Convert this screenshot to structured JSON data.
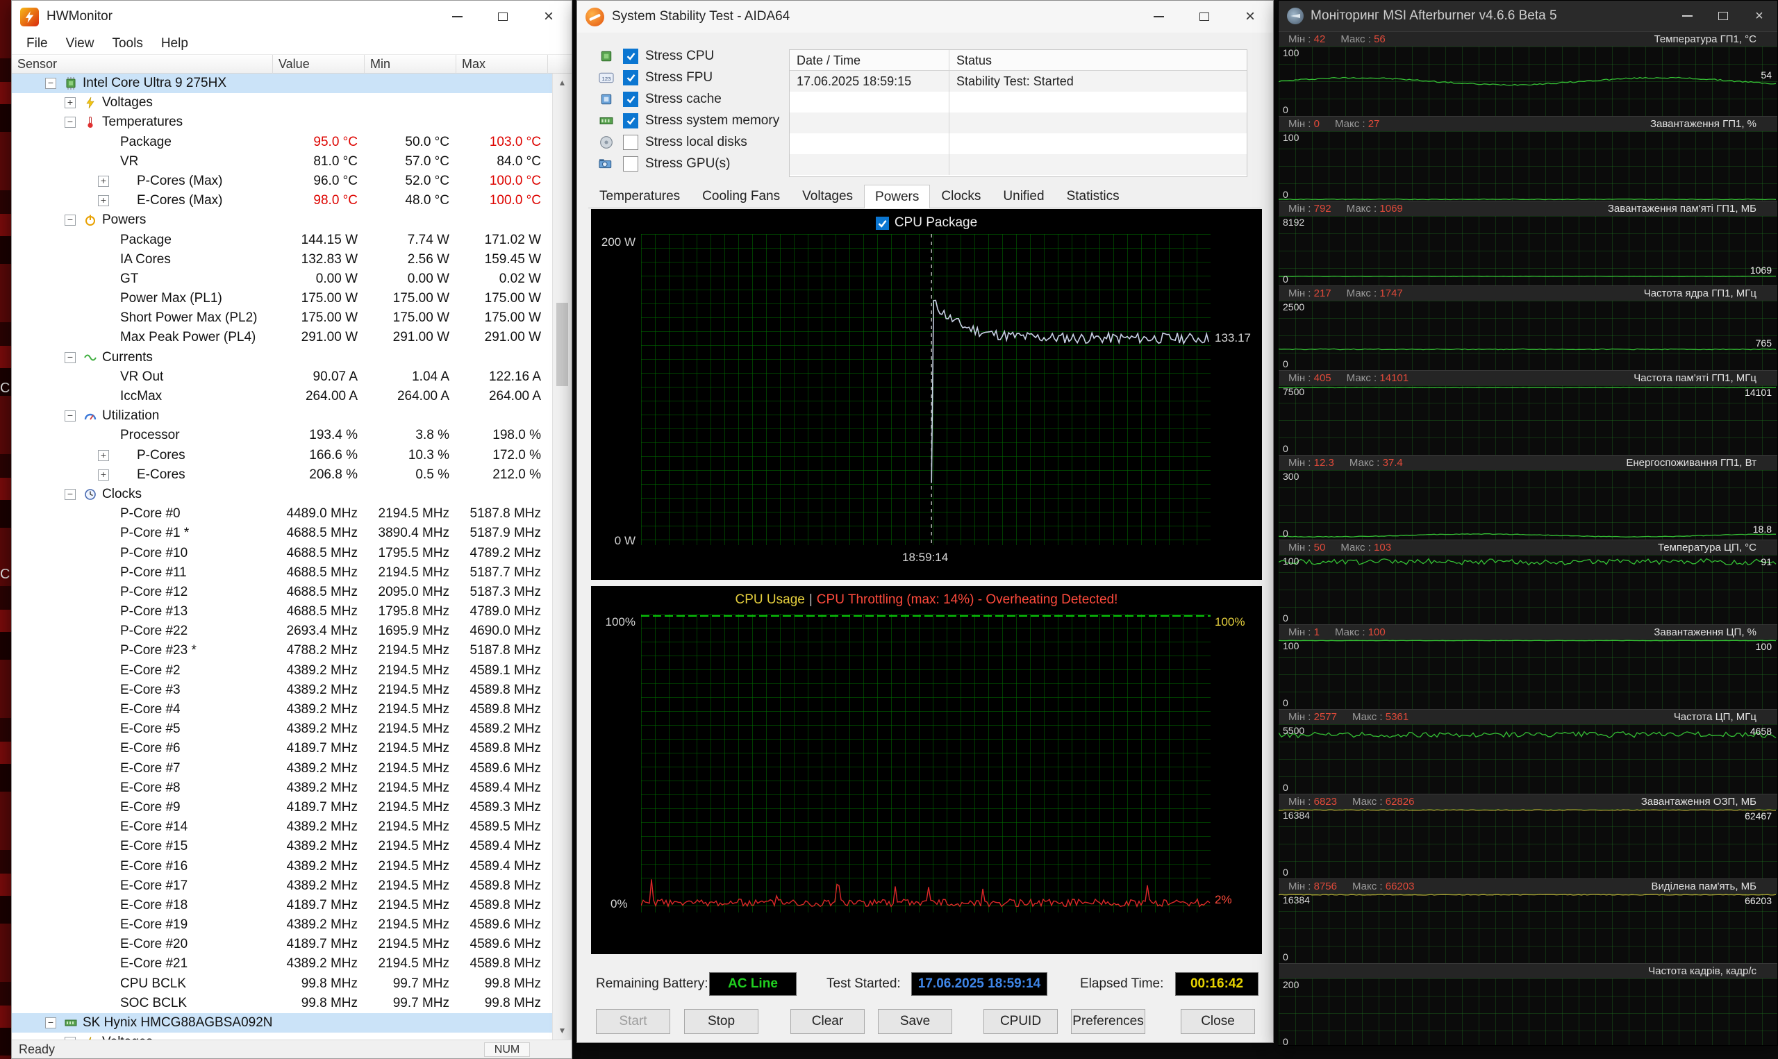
{
  "desktop": {
    "letters": [
      "C",
      "C"
    ]
  },
  "hwmonitor": {
    "title": "HWMonitor",
    "menu": [
      "File",
      "View",
      "Tools",
      "Help"
    ],
    "columns": {
      "sensor": "Sensor",
      "value": "Value",
      "min": "Min",
      "max": "Max"
    },
    "status": {
      "left": "Ready",
      "right": "NUM"
    },
    "rows": [
      {
        "kind": "device",
        "icon": "chip-icon",
        "label": "Intel Core Ultra 9 275HX",
        "selected": true,
        "expand": "-"
      },
      {
        "kind": "group",
        "icon": "voltage-icon",
        "label": "Voltages",
        "expand": "+"
      },
      {
        "kind": "group",
        "icon": "temperature-icon",
        "label": "Temperatures",
        "expand": "-"
      },
      {
        "kind": "leaf",
        "label": "Package",
        "value": "95.0 °C",
        "min": "50.0 °C",
        "max": "103.0 °C",
        "valueRed": true,
        "maxRed": true
      },
      {
        "kind": "leaf",
        "label": "VR",
        "value": "81.0 °C",
        "min": "57.0 °C",
        "max": "84.0 °C"
      },
      {
        "kind": "leaf",
        "label": "P-Cores (Max)",
        "value": "96.0 °C",
        "min": "52.0 °C",
        "max": "100.0 °C",
        "expand": "+",
        "maxRed": true
      },
      {
        "kind": "leaf",
        "label": "E-Cores (Max)",
        "value": "98.0 °C",
        "min": "48.0 °C",
        "max": "100.0 °C",
        "expand": "+",
        "valueRed": true,
        "maxRed": true
      },
      {
        "kind": "group",
        "icon": "power-icon",
        "label": "Powers",
        "expand": "-"
      },
      {
        "kind": "leaf",
        "label": "Package",
        "value": "144.15 W",
        "min": "7.74 W",
        "max": "171.02 W"
      },
      {
        "kind": "leaf",
        "label": "IA Cores",
        "value": "132.83 W",
        "min": "2.56 W",
        "max": "159.45 W"
      },
      {
        "kind": "leaf",
        "label": "GT",
        "value": "0.00 W",
        "min": "0.00 W",
        "max": "0.02 W"
      },
      {
        "kind": "leaf",
        "label": "Power Max (PL1)",
        "value": "175.00 W",
        "min": "175.00 W",
        "max": "175.00 W"
      },
      {
        "kind": "leaf",
        "label": "Short Power Max (PL2)",
        "value": "175.00 W",
        "min": "175.00 W",
        "max": "175.00 W"
      },
      {
        "kind": "leaf",
        "label": "Max Peak Power (PL4)",
        "value": "291.00 W",
        "min": "291.00 W",
        "max": "291.00 W"
      },
      {
        "kind": "group",
        "icon": "current-icon",
        "label": "Currents",
        "expand": "-"
      },
      {
        "kind": "leaf",
        "label": "VR Out",
        "value": "90.07 A",
        "min": "1.04 A",
        "max": "122.16 A"
      },
      {
        "kind": "leaf",
        "label": "IccMax",
        "value": "264.00 A",
        "min": "264.00 A",
        "max": "264.00 A"
      },
      {
        "kind": "group",
        "icon": "utilization-icon",
        "label": "Utilization",
        "expand": "-"
      },
      {
        "kind": "leaf",
        "label": "Processor",
        "value": "193.4 %",
        "min": "3.8 %",
        "max": "198.0 %"
      },
      {
        "kind": "leaf",
        "label": "P-Cores",
        "value": "166.6 %",
        "min": "10.3 %",
        "max": "172.0 %",
        "expand": "+"
      },
      {
        "kind": "leaf",
        "label": "E-Cores",
        "value": "206.8 %",
        "min": "0.5 %",
        "max": "212.0 %",
        "expand": "+"
      },
      {
        "kind": "group",
        "icon": "clock-icon",
        "label": "Clocks",
        "expand": "-"
      },
      {
        "kind": "leaf",
        "label": "P-Core #0",
        "value": "4489.0 MHz",
        "min": "2194.5 MHz",
        "max": "5187.8 MHz"
      },
      {
        "kind": "leaf",
        "label": "P-Core #1 *",
        "value": "4688.5 MHz",
        "min": "3890.4 MHz",
        "max": "5187.9 MHz"
      },
      {
        "kind": "leaf",
        "label": "P-Core #10",
        "value": "4688.5 MHz",
        "min": "1795.5 MHz",
        "max": "4789.2 MHz"
      },
      {
        "kind": "leaf",
        "label": "P-Core #11",
        "value": "4688.5 MHz",
        "min": "2194.5 MHz",
        "max": "5187.7 MHz"
      },
      {
        "kind": "leaf",
        "label": "P-Core #12",
        "value": "4688.5 MHz",
        "min": "2095.0 MHz",
        "max": "5187.3 MHz"
      },
      {
        "kind": "leaf",
        "label": "P-Core #13",
        "value": "4688.5 MHz",
        "min": "1795.8 MHz",
        "max": "4789.0 MHz"
      },
      {
        "kind": "leaf",
        "label": "P-Core #22",
        "value": "2693.4 MHz",
        "min": "1695.9 MHz",
        "max": "4690.0 MHz"
      },
      {
        "kind": "leaf",
        "label": "P-Core #23 *",
        "value": "4788.2 MHz",
        "min": "2194.5 MHz",
        "max": "5187.8 MHz"
      },
      {
        "kind": "leaf",
        "label": "E-Core #2",
        "value": "4389.2 MHz",
        "min": "2194.5 MHz",
        "max": "4589.1 MHz"
      },
      {
        "kind": "leaf",
        "label": "E-Core #3",
        "value": "4389.2 MHz",
        "min": "2194.5 MHz",
        "max": "4589.8 MHz"
      },
      {
        "kind": "leaf",
        "label": "E-Core #4",
        "value": "4389.2 MHz",
        "min": "2194.5 MHz",
        "max": "4589.8 MHz"
      },
      {
        "kind": "leaf",
        "label": "E-Core #5",
        "value": "4389.2 MHz",
        "min": "2194.5 MHz",
        "max": "4589.2 MHz"
      },
      {
        "kind": "leaf",
        "label": "E-Core #6",
        "value": "4189.7 MHz",
        "min": "2194.5 MHz",
        "max": "4589.8 MHz"
      },
      {
        "kind": "leaf",
        "label": "E-Core #7",
        "value": "4389.2 MHz",
        "min": "2194.5 MHz",
        "max": "4589.6 MHz"
      },
      {
        "kind": "leaf",
        "label": "E-Core #8",
        "value": "4389.2 MHz",
        "min": "2194.5 MHz",
        "max": "4589.4 MHz"
      },
      {
        "kind": "leaf",
        "label": "E-Core #9",
        "value": "4189.7 MHz",
        "min": "2194.5 MHz",
        "max": "4589.3 MHz"
      },
      {
        "kind": "leaf",
        "label": "E-Core #14",
        "value": "4389.2 MHz",
        "min": "2194.5 MHz",
        "max": "4589.5 MHz"
      },
      {
        "kind": "leaf",
        "label": "E-Core #15",
        "value": "4389.2 MHz",
        "min": "2194.5 MHz",
        "max": "4589.4 MHz"
      },
      {
        "kind": "leaf",
        "label": "E-Core #16",
        "value": "4389.2 MHz",
        "min": "2194.5 MHz",
        "max": "4589.4 MHz"
      },
      {
        "kind": "leaf",
        "label": "E-Core #17",
        "value": "4389.2 MHz",
        "min": "2194.5 MHz",
        "max": "4589.8 MHz"
      },
      {
        "kind": "leaf",
        "label": "E-Core #18",
        "value": "4189.7 MHz",
        "min": "2194.5 MHz",
        "max": "4589.8 MHz"
      },
      {
        "kind": "leaf",
        "label": "E-Core #19",
        "value": "4389.2 MHz",
        "min": "2194.5 MHz",
        "max": "4589.6 MHz"
      },
      {
        "kind": "leaf",
        "label": "E-Core #20",
        "value": "4189.7 MHz",
        "min": "2194.5 MHz",
        "max": "4589.6 MHz"
      },
      {
        "kind": "leaf",
        "label": "E-Core #21",
        "value": "4389.2 MHz",
        "min": "2194.5 MHz",
        "max": "4589.8 MHz"
      },
      {
        "kind": "leaf",
        "label": "CPU BCLK",
        "value": "99.8 MHz",
        "min": "99.7 MHz",
        "max": "99.8 MHz"
      },
      {
        "kind": "leaf",
        "label": "SOC BCLK",
        "value": "99.8 MHz",
        "min": "99.7 MHz",
        "max": "99.8 MHz"
      },
      {
        "kind": "device",
        "icon": "ram-icon",
        "label": "SK Hynix HMCG88AGBSA092N",
        "selected": true,
        "expand": "-"
      },
      {
        "kind": "group",
        "icon": "voltage-icon",
        "label": "Voltages",
        "expand": "+"
      }
    ]
  },
  "aida": {
    "title": "System Stability Test - AIDA64",
    "checkboxes": [
      {
        "label": "Stress CPU",
        "checked": true,
        "icon": "cpu-icon"
      },
      {
        "label": "Stress FPU",
        "checked": true,
        "icon": "fpu-icon"
      },
      {
        "label": "Stress cache",
        "checked": true,
        "icon": "cache-icon"
      },
      {
        "label": "Stress system memory",
        "checked": true,
        "icon": "memory-icon"
      },
      {
        "label": "Stress local disks",
        "checked": false,
        "icon": "disk-icon"
      },
      {
        "label": "Stress GPU(s)",
        "checked": false,
        "icon": "gpu-icon"
      }
    ],
    "log_table": {
      "col1": "Date / Time",
      "col2": "Status",
      "rows": [
        [
          "17.06.2025 18:59:15",
          "Stability Test: Started"
        ]
      ],
      "empty_rows": 4
    },
    "tabs": [
      {
        "label": "Temperatures"
      },
      {
        "label": "Cooling Fans"
      },
      {
        "label": "Voltages"
      },
      {
        "label": "Powers",
        "active": true
      },
      {
        "label": "Clocks"
      },
      {
        "label": "Unified"
      },
      {
        "label": "Statistics"
      }
    ],
    "power_graph": {
      "type": "line",
      "legend": "CPU Package",
      "y_top_label": "200 W",
      "y_bottom_label": "0 W",
      "x_start_label": "18:59:14",
      "current_label": "133.17",
      "y_max": 200,
      "start_frac": 0.51,
      "peak_w": 158,
      "settle_w": 133
    },
    "usage_graph": {
      "type": "line",
      "title_usage": "CPU Usage",
      "title_divider": "|",
      "title_throttle": "CPU Throttling (max: 14%) - Overheating Detected!",
      "left_top": "100%",
      "right_top": "100%",
      "left_bottom": "0%",
      "right_bottom": "2%",
      "usage_pct": 100,
      "throttle_base_pct": 2
    },
    "footer": {
      "battery_label": "Remaining Battery:",
      "battery_value": "AC Line",
      "started_label": "Test Started:",
      "started_value": "17.06.2025 18:59:14",
      "elapsed_label": "Elapsed Time:",
      "elapsed_value": "00:16:42"
    },
    "buttons": [
      {
        "label": "Start",
        "disabled": true
      },
      {
        "label": "Stop"
      },
      {
        "label": "Clear"
      },
      {
        "label": "Save"
      },
      {
        "label": "CPUID"
      },
      {
        "label": "Preferences"
      },
      {
        "label": "Close"
      }
    ]
  },
  "afterburner": {
    "title": "Моніторинг MSI Afterburner v4.6.6 Beta 5",
    "min_label": "Мін",
    "max_label": "Макс",
    "sections": [
      {
        "title": "Температура ГП1, °C",
        "min": "42",
        "max": "56",
        "scale_top": "100",
        "current": "54",
        "plot": {
          "base": 0.5,
          "mode": "wave",
          "amp": 0.05,
          "noise": 0.02
        }
      },
      {
        "title": "Завантаження ГП1, %",
        "min": "0",
        "max": "27",
        "scale_top": "100",
        "current": "",
        "plot": {
          "base": 0.02,
          "mode": "flat",
          "noise": 0.01
        }
      },
      {
        "title": "Завантаження пам'яті ГП1, МБ",
        "min": "792",
        "max": "1069",
        "scale_top": "8192",
        "current": "1069",
        "plot": {
          "base": 0.13,
          "mode": "flat",
          "noise": 0.004
        }
      },
      {
        "title": "Частота ядра ГП1, МГц",
        "min": "217",
        "max": "1747",
        "scale_top": "2500",
        "current": "765",
        "plot": {
          "base": 0.3,
          "mode": "flat",
          "noise": 0.012
        }
      },
      {
        "title": "Частота пам'яті ГП1, МГц",
        "min": "405",
        "max": "14101",
        "scale_top": "7500",
        "current": "14101",
        "current_at_top": true,
        "plot": {
          "base": 0.97,
          "mode": "flat",
          "noise": 0.0
        }
      },
      {
        "title": "Енергоспоживання ГП1, Вт",
        "min": "12.3",
        "max": "37.4",
        "scale_top": "300",
        "current": "18.8",
        "plot": {
          "base": 0.06,
          "mode": "wave",
          "amp": 0.02,
          "noise": 0.01
        }
      },
      {
        "title": "Температура ЦП, °C",
        "min": "50",
        "max": "103",
        "scale_top": "100",
        "current": "91",
        "plot": {
          "base": 0.9,
          "mode": "noisy",
          "amp": 0.035,
          "noise": 0.02
        }
      },
      {
        "title": "Завантаження ЦП, %",
        "min": "1",
        "max": "100",
        "scale_top": "100",
        "current": "100",
        "current_at_top": true,
        "plot": {
          "base": 0.985,
          "mode": "flat",
          "noise": 0.004
        }
      },
      {
        "title": "Частота ЦП, МГц",
        "min": "2577",
        "max": "5361",
        "scale_top": "5500",
        "current": "4658",
        "plot": {
          "base": 0.85,
          "mode": "noisy",
          "amp": 0.04,
          "noise": 0.02
        }
      },
      {
        "title": "Завантаження ОЗП, МБ",
        "min": "6823",
        "max": "62826",
        "scale_top": "16384",
        "current": "62467",
        "current_at_top": true,
        "plot": {
          "base": 0.985,
          "mode": "flat",
          "noise": 0.0,
          "color": "#b7a63b"
        }
      },
      {
        "title": "Виділена пам'ять, МБ",
        "min": "8756",
        "max": "66203",
        "scale_top": "16384",
        "current": "66203",
        "current_at_top": true,
        "plot": {
          "base": 0.985,
          "mode": "flat",
          "noise": 0.0,
          "color": "#b7a63b"
        }
      },
      {
        "title": "Частота кадрів, кадр/с",
        "min": "",
        "max": "",
        "scale_top": "200",
        "current": "",
        "plot": {
          "base": 0.012,
          "mode": "flat",
          "noise": 0.0
        }
      }
    ]
  }
}
